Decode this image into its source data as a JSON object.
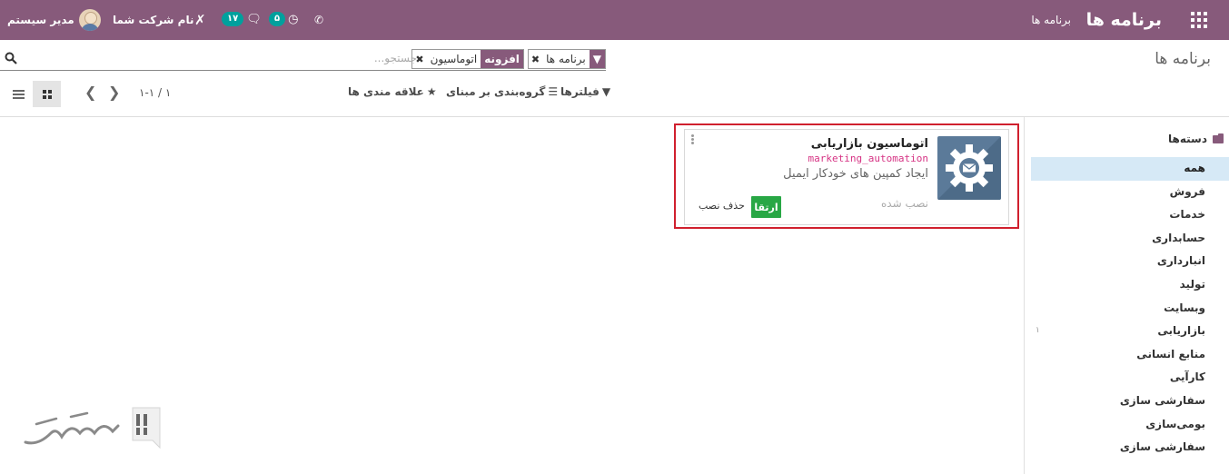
{
  "navbar": {
    "brand": "برنامه ها",
    "menu_apps": "برنامه ها",
    "user_name": "مدیر سیستم",
    "company_name": "نام شرکت شما",
    "messages_count": "۱۷",
    "activities_count": "۵",
    "icons": [
      "apps-grid-icon",
      "tools-icon",
      "chat-icon",
      "clock-icon",
      "phone-icon"
    ]
  },
  "breadcrumb": "برنامه ها",
  "search": {
    "placeholder": "جستجو...",
    "facet_1": {
      "value": "برنامه ها"
    },
    "facet_2": {
      "category": "افزونه",
      "value": "اتوماسیون"
    }
  },
  "controls": {
    "filters": "فیلترها",
    "group_by": "گروه‌بندی بر مبنای",
    "favorites": "علاقه مندی ها",
    "pager": "۱-۱ / ۱"
  },
  "sidebar": {
    "title": "دسته‌ها",
    "categories": [
      {
        "label": "همه",
        "active": true,
        "count": ""
      },
      {
        "label": "فروش",
        "count": ""
      },
      {
        "label": "خدمات",
        "count": ""
      },
      {
        "label": "حسابداری",
        "count": ""
      },
      {
        "label": "انبارداری",
        "count": ""
      },
      {
        "label": "تولید",
        "count": ""
      },
      {
        "label": "وبسایت",
        "count": ""
      },
      {
        "label": "بازاریابی",
        "count": "۱"
      },
      {
        "label": "منابع انسانی",
        "count": ""
      },
      {
        "label": "کارآیی",
        "count": ""
      },
      {
        "label": "سفارشی سازی",
        "count": ""
      },
      {
        "label": "بومی‌سازی",
        "count": ""
      },
      {
        "label": "سفارشی سازی",
        "count": ""
      }
    ]
  },
  "module_card": {
    "name": "اتوماسیون بازاریابی",
    "technical_name": "marketing_automation",
    "summary": "ایجاد کمپین های خودکار ایمیل",
    "status": "نصب شده",
    "upgrade_button": "ارتقا",
    "uninstall_button": "حذف نصب",
    "icon": "gear-mail-icon"
  },
  "colors": {
    "brand": "#875a7b",
    "highlight": "#d0202e",
    "upgrade": "#28a745",
    "active_category": "#d6e9f6"
  }
}
